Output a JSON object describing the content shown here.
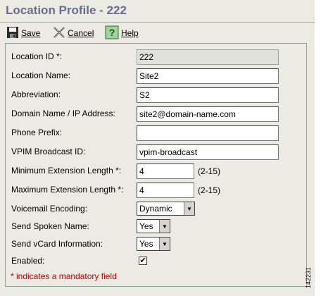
{
  "page": {
    "title": "Location Profile - 222"
  },
  "toolbar": {
    "save_label": "Save",
    "cancel_label": "Cancel",
    "help_label": "Help"
  },
  "form": {
    "location_id": {
      "label": "Location ID *:",
      "value": "222"
    },
    "location_name": {
      "label": "Location Name:",
      "value": "Site2"
    },
    "abbreviation": {
      "label": "Abbreviation:",
      "value": "S2"
    },
    "domain": {
      "label": "Domain Name / IP Address:",
      "value": "site2@domain-name.com"
    },
    "phone_prefix": {
      "label": "Phone Prefix:",
      "value": ""
    },
    "vpim_broadcast": {
      "label": "VPIM Broadcast ID:",
      "value": "vpim-broadcast"
    },
    "min_ext": {
      "label": "Minimum Extension Length *:",
      "value": "4",
      "range": "(2-15)"
    },
    "max_ext": {
      "label": "Maximum Extension Length *:",
      "value": "4",
      "range": "(2-15)"
    },
    "voicemail_encoding": {
      "label": "Voicemail Encoding:",
      "selected": "Dynamic"
    },
    "send_spoken_name": {
      "label": "Send Spoken Name:",
      "selected": "Yes"
    },
    "send_vcard": {
      "label": "Send vCard Information:",
      "selected": "Yes"
    },
    "enabled": {
      "label": "Enabled:",
      "checked": true,
      "mark": "✔"
    }
  },
  "footer_note": "* indicates a mandatory field",
  "side_id": "142231",
  "colors": {
    "title": "#6b6b91",
    "mandatory_note": "#cc0000",
    "panel_border": "#7fa8a3"
  }
}
